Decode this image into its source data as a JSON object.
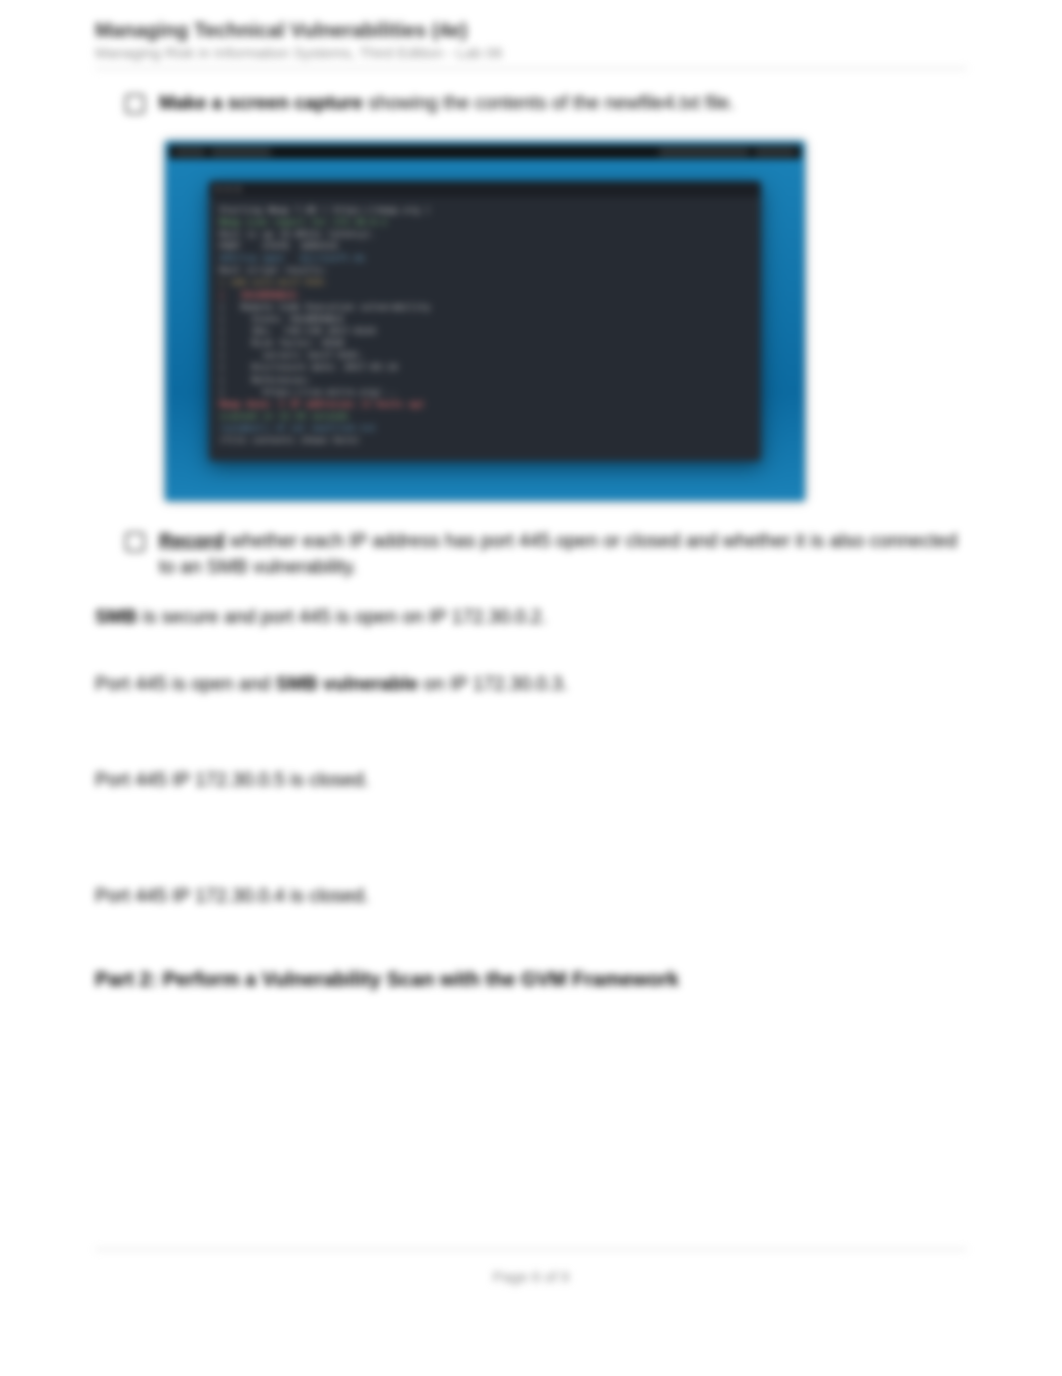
{
  "header": {
    "title": "Managing Technical Vulnerabilities (4e)",
    "subtitle": "Managing Risk in Information Systems, Third Edition - Lab 06"
  },
  "bullets": {
    "b1_bold": "Make a screen capture",
    "b1_rest": " showing the contents of the newfile4.txt file.",
    "b2_uline": "Record",
    "b2_rest": " whether each IP address has port 445 open or closed and whether it is also connected to an SMB vulnerability."
  },
  "screenshot": {
    "alt": "Kali Linux desktop with a terminal window showing nmap smb-vuln scan output",
    "lines": [
      {
        "cls": "",
        "t": "Starting Nmap 7.80 ( https://nmap.org )"
      },
      {
        "cls": "tg",
        "t": "Nmap scan report for 172.30.0.2"
      },
      {
        "cls": "",
        "t": "Host is up (0.0012s latency)."
      },
      {
        "cls": "",
        "t": "PORT    STATE  SERVICE"
      },
      {
        "cls": "tc",
        "t": "445/tcp open   microsoft-ds"
      },
      {
        "cls": "",
        "t": "Host script results:"
      },
      {
        "cls": "to",
        "t": "| smb-vuln-ms17-010:"
      },
      {
        "cls": "tr",
        "t": "|   VULNERABLE:"
      },
      {
        "cls": "",
        "t": "|   Remote Code Execution vulnerability"
      },
      {
        "cls": "",
        "t": "|     State: VULNERABLE"
      },
      {
        "cls": "",
        "t": "|     IDs:  CVE:CVE-2017-0143"
      },
      {
        "cls": "",
        "t": "|     Risk factor: HIGH"
      },
      {
        "cls": "",
        "t": "|       servers (ms17-010)."
      },
      {
        "cls": "",
        "t": "|     Disclosure date: 2017-03-14"
      },
      {
        "cls": "",
        "t": "|     References:"
      },
      {
        "cls": "",
        "t": "|       https://cve.mitre.org/..."
      },
      {
        "cls": "",
        "t": ""
      },
      {
        "cls": "tr",
        "t": "Nmap done: 3 IP addresses (3 hosts up)"
      },
      {
        "cls": "tg",
        "t": "scanned in 12.34 seconds"
      },
      {
        "cls": "",
        "t": ""
      },
      {
        "cls": "tc",
        "t": "root@kali:~# cat newfile4.txt"
      },
      {
        "cls": "",
        "t": "(file contents shown here)"
      }
    ]
  },
  "paragraphs": {
    "p1_bold": "SMB",
    "p1_rest": " is secure and port 445 is open on IP 172.30.0.2.",
    "p2_a": "Port 445 is open and ",
    "p2_bold": "SMB vulnerable",
    "p2_b": " on IP 172.30.0.3.",
    "p3": "Port 445 IP 172.30.0.5 is closed.",
    "p4": "Port 445  IP 172.30.0.4 is closed."
  },
  "section_heading": "Part 2: Perform a Vulnerability Scan with the GVM Framework",
  "footer": "Page 6 of 9"
}
